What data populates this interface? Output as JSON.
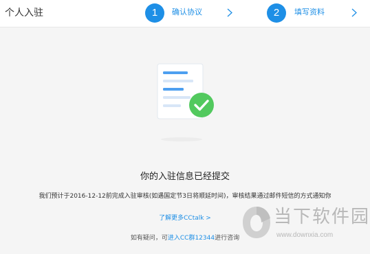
{
  "header": {
    "title": "个人入驻",
    "steps": [
      {
        "number": "1",
        "label": "确认协议"
      },
      {
        "number": "2",
        "label": "填写资料"
      }
    ]
  },
  "main": {
    "heading": "你的入驻信息已经提交",
    "description": "我们预计于2016-12-12前完成入驻审核(如遇国定节3日将顺延时间)，审核结果通过邮件短信的方式通知你",
    "learn_more": "了解更多CCtalk >",
    "contact_prefix": "如有疑问，可",
    "contact_link": "进入CC群12344",
    "contact_suffix": "进行咨询"
  },
  "watermark": {
    "title": "当下软件园",
    "url": "www.downxia.com"
  },
  "colors": {
    "accent": "#1e8fe6",
    "success": "#4cc65a",
    "background": "#f5f5f5"
  }
}
